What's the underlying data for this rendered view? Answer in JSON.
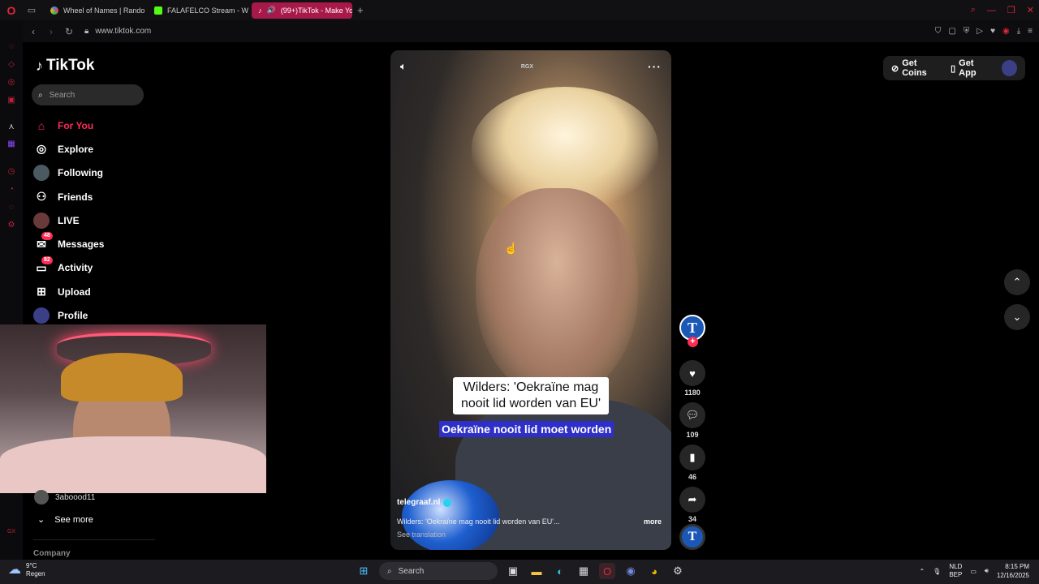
{
  "browser": {
    "tabs": [
      {
        "title": "Wheel of Names | Rando",
        "color": "#3b82f6"
      },
      {
        "title": "FALAFELCO Stream - Wa",
        "color": "#53fc18"
      },
      {
        "title": "(99+)TikTok - Make Yo",
        "color": "#ffffff"
      }
    ],
    "url": "www.tiktok.com"
  },
  "tiktok": {
    "logo": "TikTok",
    "search_placeholder": "Search",
    "nav": [
      {
        "label": "For You",
        "icon": "home-icon"
      },
      {
        "label": "Explore",
        "icon": "compass-icon"
      },
      {
        "label": "Following",
        "icon": "following-avatar-icon"
      },
      {
        "label": "Friends",
        "icon": "friends-icon"
      },
      {
        "label": "LIVE",
        "icon": "live-avatar-icon"
      },
      {
        "label": "Messages",
        "icon": "messages-icon",
        "badge": "48"
      },
      {
        "label": "Activity",
        "icon": "activity-icon",
        "badge": "82"
      },
      {
        "label": "Upload",
        "icon": "upload-icon"
      },
      {
        "label": "Profile",
        "icon": "profile-avatar-icon"
      }
    ],
    "following_account": "3aboood11",
    "see_more": "See more",
    "company": "Company",
    "header": {
      "get_coins": "Get Coins",
      "get_app": "Get App"
    }
  },
  "video": {
    "watermark": "RGX",
    "caption_overlay": "Wilders: 'Oekraïne mag nooit lid worden van EU'",
    "subtitle": "Oekraïne nooit lid moet worden",
    "author": "telegraaf.nl",
    "description": "Wilders: 'Oekraïne mag nooit lid worden van EU'...",
    "more": "more",
    "see_translation": "See translation",
    "creator_initial": "T",
    "likes": "1180",
    "comments": "109",
    "saves": "46",
    "shares": "34"
  },
  "taskbar": {
    "weather_temp": "9°C",
    "weather_desc": "Regen",
    "search": "Search",
    "lang_top": "NLD",
    "lang_bottom": "BEP",
    "time": "8:15 PM",
    "date": "12/16/2025"
  },
  "colors": {
    "accent": "#fe2c55",
    "active_tab": "#a8194a",
    "subtitle_bg": "#2e2ec8"
  }
}
